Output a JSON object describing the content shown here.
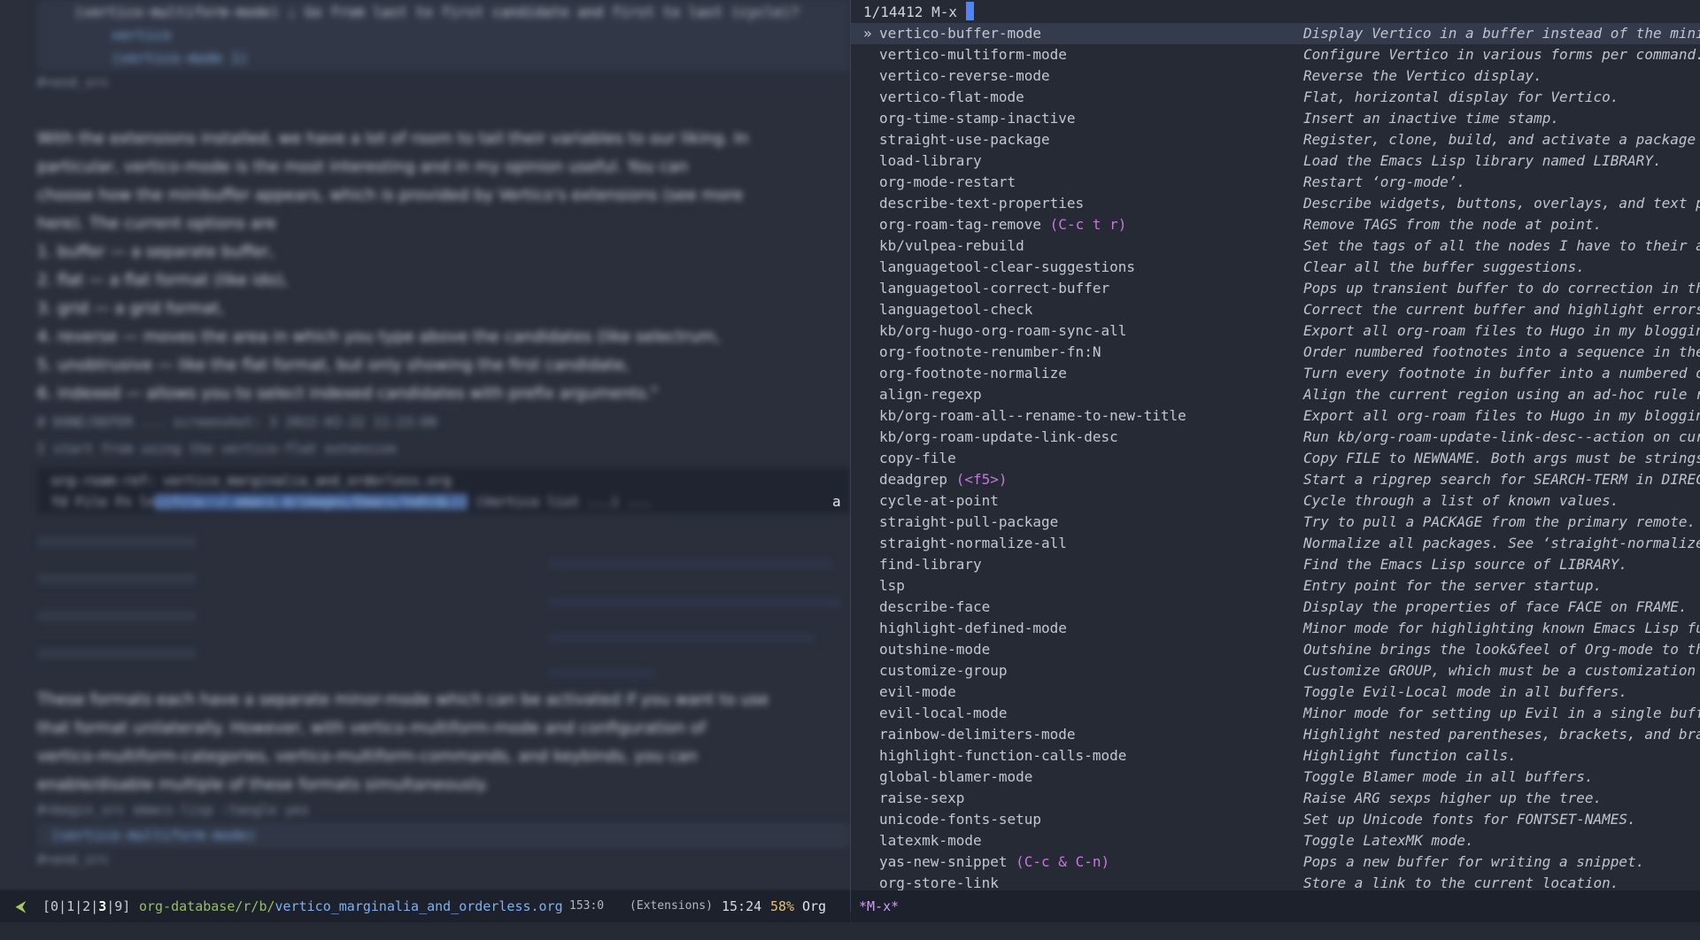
{
  "left_buffer": {
    "src_block_lines": [
      "(vertico-multiform-mode) ; Go from last to first candidate and first to last (cycle)?",
      "  vertico",
      "  (vertico-mode 1)"
    ],
    "end_src": "#+end_src",
    "prose_lines": [
      "With the extensions installed, we have a lot of room to tail their variables to our liking. In",
      "particular, vertico-mode is the most interesting and in my opinion useful. You can",
      "choose how the minibuffer appears, which is provided by Vertico's extensions (see more",
      "here). The current options are"
    ],
    "list_lines": [
      "1. buffer — a separate buffer,",
      "2. flat — a flat format (like ido),",
      "3. grid — a grid format,",
      "4. reverse — moves the area in which you type above the candidates (like selectrum,",
      "5. unobtrusive — like the flat format, but only showing the first candidate,",
      "6. indexed — allows you to select indexed candidates with prefix arguments.\""
    ],
    "meta_lines": [
      "# DONE/DEFER ... screenshot: 3 2022-03-22 11:23:00",
      "I start from using the vertico-flat extension"
    ],
    "popup_line1": "org-roam-ref: vertico_marginalia_and_orderless.org",
    "popup_line2_prefix": "  fd  File Fn  ln",
    "popup_line2_highlight": "[[file:~/.emacs.d/images/Emacs/VeDiQL]]",
    "popup_line2_suffix": " (Vertico list ...) ...",
    "later_prose": [
      "These formats each have a separate minor-mode which can be activated if you want to use",
      "that format unilaterally. However, with vertico-multiform-mode and configuration of",
      "vertico-multiform-categories, vertico-multiform-commands, and keybinds, you can",
      "enable/disable multiple of these formats simultaneously."
    ],
    "begin_src": "#+begin_src emacs-lisp :tangle yes",
    "end_src2": "#+end_src",
    "src2": "  (vertico-multiform-mode)",
    "cursor_char": "a"
  },
  "minibuffer": {
    "prompt": "1/14412 M-x",
    "selected_marker": "»",
    "candidates": [
      {
        "name": "vertico-buffer-mode",
        "key": "",
        "annotation": "Display Vertico in a buffer instead of the minibu"
      },
      {
        "name": "vertico-multiform-mode",
        "key": "",
        "annotation": "Configure Vertico in various forms per command."
      },
      {
        "name": "vertico-reverse-mode",
        "key": "",
        "annotation": "Reverse the Vertico display."
      },
      {
        "name": "vertico-flat-mode",
        "key": "",
        "annotation": "Flat, horizontal display for Vertico."
      },
      {
        "name": "org-time-stamp-inactive",
        "key": "",
        "annotation": "Insert an inactive time stamp."
      },
      {
        "name": "straight-use-package",
        "key": "",
        "annotation": "Register, clone, build, and activate a package and"
      },
      {
        "name": "load-library",
        "key": "",
        "annotation": "Load the Emacs Lisp library named LIBRARY."
      },
      {
        "name": "org-mode-restart",
        "key": "",
        "annotation": "Restart ‘org-mode’."
      },
      {
        "name": "describe-text-properties",
        "key": "",
        "annotation": "Describe widgets, buttons, overlays, and text prop"
      },
      {
        "name": "org-roam-tag-remove",
        "key": "(C-c t r)",
        "annotation": "Remove TAGS from the node at point."
      },
      {
        "name": "kb/vulpea-rebuild",
        "key": "",
        "annotation": "Set the tags of all the nodes I have to their app"
      },
      {
        "name": "languagetool-clear-suggestions",
        "key": "",
        "annotation": "Clear all the buffer suggestions."
      },
      {
        "name": "languagetool-correct-buffer",
        "key": "",
        "annotation": "Pops up transient buffer to do correction in the w"
      },
      {
        "name": "languagetool-check",
        "key": "",
        "annotation": "Correct the current buffer and highlight errors."
      },
      {
        "name": "kb/org-hugo-org-roam-sync-all",
        "key": "",
        "annotation": "Export all org-roam files to Hugo in my blogging d"
      },
      {
        "name": "org-footnote-renumber-fn:N",
        "key": "",
        "annotation": "Order numbered footnotes into a sequence in the do"
      },
      {
        "name": "org-footnote-normalize",
        "key": "",
        "annotation": "Turn every footnote in buffer into a numbered one"
      },
      {
        "name": "align-regexp",
        "key": "",
        "annotation": "Align the current region using an ad-hoc rule read"
      },
      {
        "name": "kb/org-roam-all--rename-to-new-title",
        "key": "",
        "annotation": "Export all org-roam files to Hugo in my blogging d"
      },
      {
        "name": "kb/org-roam-update-link-desc",
        "key": "",
        "annotation": "Run kb/org-roam-update-link-desc--action on curre"
      },
      {
        "name": "copy-file",
        "key": "",
        "annotation": "Copy FILE to NEWNAME.  Both args must be strings."
      },
      {
        "name": "deadgrep",
        "key": "(<f5>)",
        "annotation": "Start a ripgrep search for SEARCH-TERM in DIRECTOR"
      },
      {
        "name": "cycle-at-point",
        "key": "",
        "annotation": "Cycle through a list of known values."
      },
      {
        "name": "straight-pull-package",
        "key": "",
        "annotation": "Try to pull a PACKAGE from the primary remote."
      },
      {
        "name": "straight-normalize-all",
        "key": "",
        "annotation": "Normalize all packages. See ‘straight-normalize-pa"
      },
      {
        "name": "find-library",
        "key": "",
        "annotation": "Find the Emacs Lisp source of LIBRARY."
      },
      {
        "name": "lsp",
        "key": "",
        "annotation": "Entry point for the server startup."
      },
      {
        "name": "describe-face",
        "key": "",
        "annotation": "Display the properties of face FACE on FRAME."
      },
      {
        "name": "highlight-defined-mode",
        "key": "",
        "annotation": "Minor mode for highlighting known Emacs Lisp func"
      },
      {
        "name": "outshine-mode",
        "key": "",
        "annotation": "Outshine brings the look&feel of Org-mode to the"
      },
      {
        "name": "customize-group",
        "key": "",
        "annotation": "Customize GROUP, which must be a customization gro"
      },
      {
        "name": "evil-mode",
        "key": "",
        "annotation": "Toggle Evil-Local mode in all buffers."
      },
      {
        "name": "evil-local-mode",
        "key": "",
        "annotation": "Minor mode for setting up Evil in a single buffer"
      },
      {
        "name": "rainbow-delimiters-mode",
        "key": "",
        "annotation": "Highlight nested parentheses, brackets, and braces"
      },
      {
        "name": "highlight-function-calls-mode",
        "key": "",
        "annotation": "Highlight function calls."
      },
      {
        "name": "global-blamer-mode",
        "key": "",
        "annotation": "Toggle Blamer mode in all buffers."
      },
      {
        "name": "raise-sexp",
        "key": "",
        "annotation": "Raise ARG sexps higher up the tree."
      },
      {
        "name": "unicode-fonts-setup",
        "key": "",
        "annotation": "Set up Unicode fonts for FONTSET-NAMES."
      },
      {
        "name": "latexmk-mode",
        "key": "",
        "annotation": "Toggle LatexMK mode."
      },
      {
        "name": "yas-new-snippet",
        "key": "(C-c & C-n)",
        "annotation": "Pops a new buffer for writing a snippet."
      },
      {
        "name": "org-store-link",
        "key": "",
        "annotation": "Store a link to the current location."
      }
    ]
  },
  "mode_line": {
    "icon": "⮜",
    "workspaces_prefix": "[0|1|2|",
    "workspace_current": "3",
    "workspaces_suffix": "|9]",
    "dir": "org-database/r/b/",
    "file": "vertico_marginalia_and_orderless.org",
    "position": "153:0",
    "extensions": "(Extensions)",
    "time": "15:24",
    "percent": "58%",
    "major_mode": "Org",
    "buffer_name": "*M-x*"
  },
  "colors": {
    "background": "#262a35",
    "selection": "#343b4d",
    "cursor": "#4f83f7",
    "keybinding": "#c678dd",
    "file_path": "#98be65",
    "file_name": "#7fb0ef",
    "percent": "#e5c07b"
  }
}
